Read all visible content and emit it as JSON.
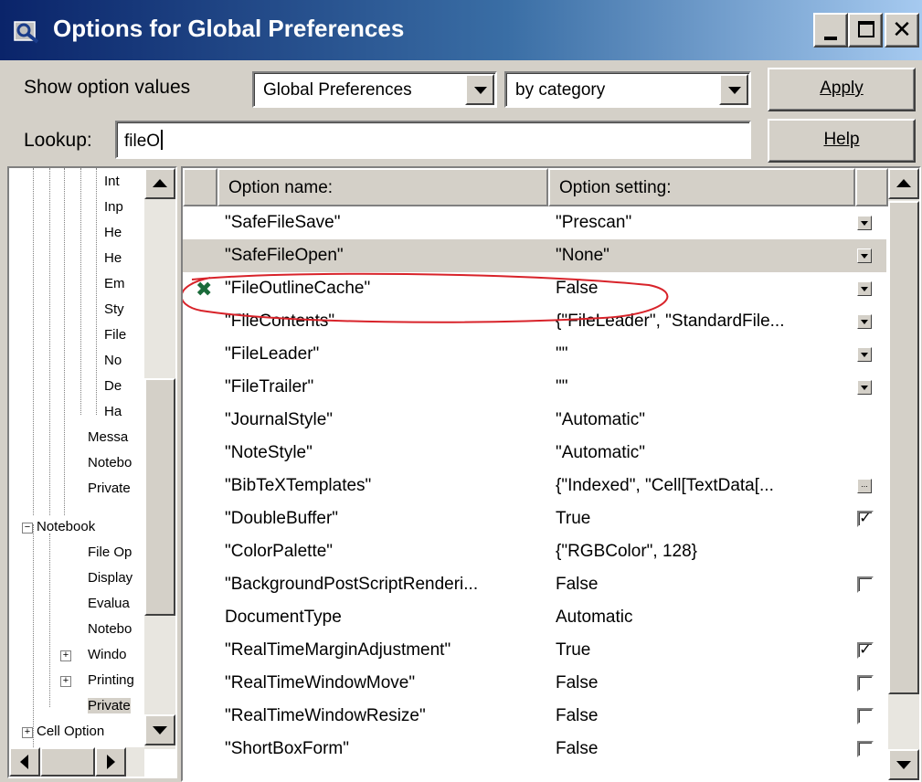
{
  "window": {
    "title": "Options for Global Preferences"
  },
  "toolbar": {
    "show_label": "Show option values",
    "scope_value": "Global Preferences",
    "view_value": "by category",
    "apply_label": "Apply",
    "lookup_label": "Lookup:",
    "lookup_value": "fileO",
    "help_label": "Help"
  },
  "tree": {
    "items": [
      "Int",
      "Inp",
      "He",
      "He",
      "Em",
      "Sty",
      "File",
      "No",
      "De",
      "Ha",
      "Messa",
      "Notebo",
      "Private",
      "Notebook",
      "File Op",
      "Display",
      "Evalua",
      "Notebo",
      "Windo",
      "Printing",
      "Private",
      "Cell Option"
    ]
  },
  "grid": {
    "col_name": "Option name:",
    "col_setting": "Option setting:",
    "rows": [
      {
        "name": "\"SafeFileSave\"",
        "setting": "\"Prescan\"",
        "control": "dropdown"
      },
      {
        "name": "\"SafeFileOpen\"",
        "setting": "\"None\"",
        "control": "dropdown",
        "selected": true
      },
      {
        "name": "\"FileOutlineCache\"",
        "setting": "False",
        "control": "dropdown",
        "marked": true
      },
      {
        "name": "\"FileContents\"",
        "setting": "{\"FileLeader\", \"StandardFile...",
        "control": "dropdown"
      },
      {
        "name": "\"FileLeader\"",
        "setting": "\"\"",
        "control": "dropdown"
      },
      {
        "name": "\"FileTrailer\"",
        "setting": "\"\"",
        "control": "dropdown"
      },
      {
        "name": "\"JournalStyle\"",
        "setting": "\"Automatic\"",
        "control": "none"
      },
      {
        "name": "\"NoteStyle\"",
        "setting": "\"Automatic\"",
        "control": "none"
      },
      {
        "name": "\"BibTeXTemplates\"",
        "setting": "{\"Indexed\", \"Cell[TextData[...",
        "control": "dots"
      },
      {
        "name": "\"DoubleBuffer\"",
        "setting": "True",
        "control": "checked"
      },
      {
        "name": "\"ColorPalette\"",
        "setting": "{\"RGBColor\", 128}",
        "control": "none"
      },
      {
        "name": "\"BackgroundPostScriptRenderi...",
        "setting": "False",
        "control": "unchecked"
      },
      {
        "name": "DocumentType",
        "setting": "Automatic",
        "control": "none"
      },
      {
        "name": "\"RealTimeMarginAdjustment\"",
        "setting": "True",
        "control": "checked"
      },
      {
        "name": "\"RealTimeWindowMove\"",
        "setting": "False",
        "control": "unchecked"
      },
      {
        "name": "\"RealTimeWindowResize\"",
        "setting": "False",
        "control": "unchecked"
      },
      {
        "name": "\"ShortBoxForm\"",
        "setting": "False",
        "control": "unchecked"
      }
    ]
  },
  "icons": {
    "app": "options-inspector-icon",
    "marker": "modified-marker-icon"
  },
  "colors": {
    "title_start": "#0a246a",
    "title_end": "#a6caf0",
    "annotation": "#d8232a",
    "marker": "#1a6b3a"
  }
}
